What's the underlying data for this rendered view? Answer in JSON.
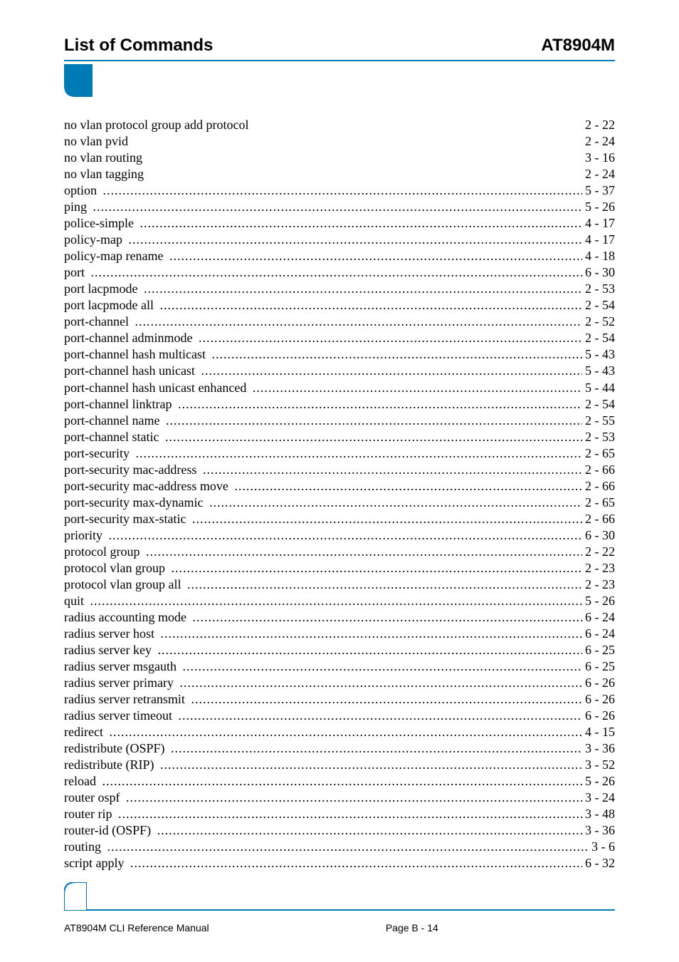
{
  "header": {
    "left": "List of Commands",
    "right": "AT8904M"
  },
  "toc": [
    {
      "label": "no vlan protocol group add protocol",
      "page": "2 - 22",
      "dotted": false
    },
    {
      "label": "no vlan pvid",
      "page": "2 - 24",
      "dotted": false
    },
    {
      "label": "no vlan routing",
      "page": "3 - 16",
      "dotted": false
    },
    {
      "label": "no vlan tagging",
      "page": "2 - 24",
      "dotted": false
    },
    {
      "label": "option",
      "page": "5 - 37",
      "dotted": true
    },
    {
      "label": "ping",
      "page": "5 - 26",
      "dotted": true
    },
    {
      "label": "police-simple",
      "page": "4 - 17",
      "dotted": true
    },
    {
      "label": "policy-map",
      "page": "4 - 17",
      "dotted": true
    },
    {
      "label": "policy-map rename",
      "page": "4 - 18",
      "dotted": true
    },
    {
      "label": "port",
      "page": "6 - 30",
      "dotted": true
    },
    {
      "label": "port lacpmode",
      "page": "2 - 53",
      "dotted": true
    },
    {
      "label": "port lacpmode all",
      "page": "2 - 54",
      "dotted": true
    },
    {
      "label": "port-channel",
      "page": "2 - 52",
      "dotted": true
    },
    {
      "label": "port-channel adminmode",
      "page": "2 - 54",
      "dotted": true
    },
    {
      "label": "port-channel hash multicast",
      "page": "5 - 43",
      "dotted": true
    },
    {
      "label": "port-channel hash unicast",
      "page": "5 - 43",
      "dotted": true
    },
    {
      "label": "port-channel hash unicast enhanced",
      "page": "5 - 44",
      "dotted": true
    },
    {
      "label": "port-channel linktrap",
      "page": "2 - 54",
      "dotted": true
    },
    {
      "label": "port-channel name",
      "page": "2 - 55",
      "dotted": true
    },
    {
      "label": "port-channel static",
      "page": "2 - 53",
      "dotted": true
    },
    {
      "label": "port-security",
      "page": "2 - 65",
      "dotted": true
    },
    {
      "label": "port-security mac-address",
      "page": "2 - 66",
      "dotted": true
    },
    {
      "label": "port-security mac-address move",
      "page": "2 - 66",
      "dotted": true
    },
    {
      "label": "port-security max-dynamic",
      "page": "2 - 65",
      "dotted": true
    },
    {
      "label": "port-security max-static",
      "page": "2 - 66",
      "dotted": true
    },
    {
      "label": "priority",
      "page": "6 - 30",
      "dotted": true
    },
    {
      "label": "protocol group",
      "page": "2 - 22",
      "dotted": true
    },
    {
      "label": "protocol vlan group",
      "page": "2 - 23",
      "dotted": true
    },
    {
      "label": "protocol vlan group all",
      "page": "2 - 23",
      "dotted": true
    },
    {
      "label": "quit",
      "page": "5 - 26",
      "dotted": true
    },
    {
      "label": "radius accounting mode",
      "page": "6 - 24",
      "dotted": true
    },
    {
      "label": "radius server host",
      "page": "6 - 24",
      "dotted": true
    },
    {
      "label": "radius server key",
      "page": "6 - 25",
      "dotted": true
    },
    {
      "label": "radius server msgauth",
      "page": "6 - 25",
      "dotted": true
    },
    {
      "label": "radius server primary",
      "page": "6 - 26",
      "dotted": true
    },
    {
      "label": "radius server retransmit",
      "page": "6 - 26",
      "dotted": true
    },
    {
      "label": "radius server timeout",
      "page": "6 - 26",
      "dotted": true
    },
    {
      "label": "redirect",
      "page": "4 - 15",
      "dotted": true
    },
    {
      "label": "redistribute (OSPF)",
      "page": "3 - 36",
      "dotted": true
    },
    {
      "label": "redistribute (RIP)",
      "page": "3 - 52",
      "dotted": true
    },
    {
      "label": "reload",
      "page": "5 - 26",
      "dotted": true
    },
    {
      "label": "router ospf",
      "page": "3 - 24",
      "dotted": true
    },
    {
      "label": "router rip",
      "page": "3 - 48",
      "dotted": true
    },
    {
      "label": "router-id (OSPF)",
      "page": "3 - 36",
      "dotted": true
    },
    {
      "label": "routing",
      "page": "3 - 6",
      "dotted": true
    },
    {
      "label": "script apply",
      "page": "6 - 32",
      "dotted": true
    }
  ],
  "footer": {
    "left": "AT8904M CLI Reference Manual",
    "center": "Page B - 14",
    "right": ""
  }
}
